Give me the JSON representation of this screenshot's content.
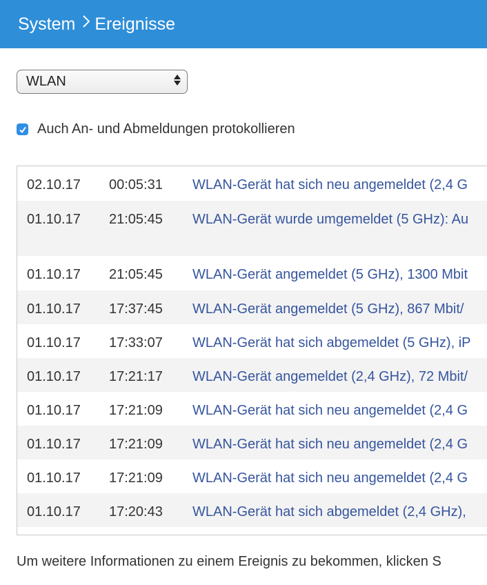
{
  "header": {
    "breadcrumb_root": "System",
    "breadcrumb_current": "Ereignisse"
  },
  "filter": {
    "selected": "WLAN"
  },
  "options": {
    "log_logins_label": "Auch An- und Abmeldungen protokollieren",
    "log_logins_checked": true
  },
  "events": [
    {
      "date": "02.10.17",
      "time": "00:05:31",
      "message": "WLAN-Gerät hat sich neu angemeldet (2,4 G"
    },
    {
      "date": "01.10.17",
      "time": "21:05:45",
      "message": "WLAN-Gerät wurde umgemeldet (5 GHz): Au"
    },
    {
      "date": "01.10.17",
      "time": "21:05:45",
      "message": "WLAN-Gerät angemeldet (5 GHz), 1300 Mbit"
    },
    {
      "date": "01.10.17",
      "time": "17:37:45",
      "message": "WLAN-Gerät angemeldet (5 GHz), 867 Mbit/"
    },
    {
      "date": "01.10.17",
      "time": "17:33:07",
      "message": "WLAN-Gerät hat sich abgemeldet (5 GHz), iP"
    },
    {
      "date": "01.10.17",
      "time": "17:21:17",
      "message": "WLAN-Gerät angemeldet (2,4 GHz), 72 Mbit/"
    },
    {
      "date": "01.10.17",
      "time": "17:21:09",
      "message": "WLAN-Gerät hat sich neu angemeldet (2,4 G"
    },
    {
      "date": "01.10.17",
      "time": "17:21:09",
      "message": "WLAN-Gerät hat sich neu angemeldet (2,4 G"
    },
    {
      "date": "01.10.17",
      "time": "17:21:09",
      "message": "WLAN-Gerät hat sich neu angemeldet (2,4 G"
    },
    {
      "date": "01.10.17",
      "time": "17:20:43",
      "message": "WLAN-Gerät hat sich abgemeldet (2,4 GHz),"
    }
  ],
  "footer": {
    "text": "Um weitere Informationen zu einem Ereignis zu bekommen, klicken S"
  },
  "colors": {
    "header_bg": "#2e8ed8",
    "link": "#36559e",
    "checkbox": "#2f8ee5"
  },
  "icons": {
    "breadcrumb_separator": "chevron-right-icon",
    "select_arrows": "updown-arrows-icon",
    "checkbox": "checkmark-icon"
  }
}
